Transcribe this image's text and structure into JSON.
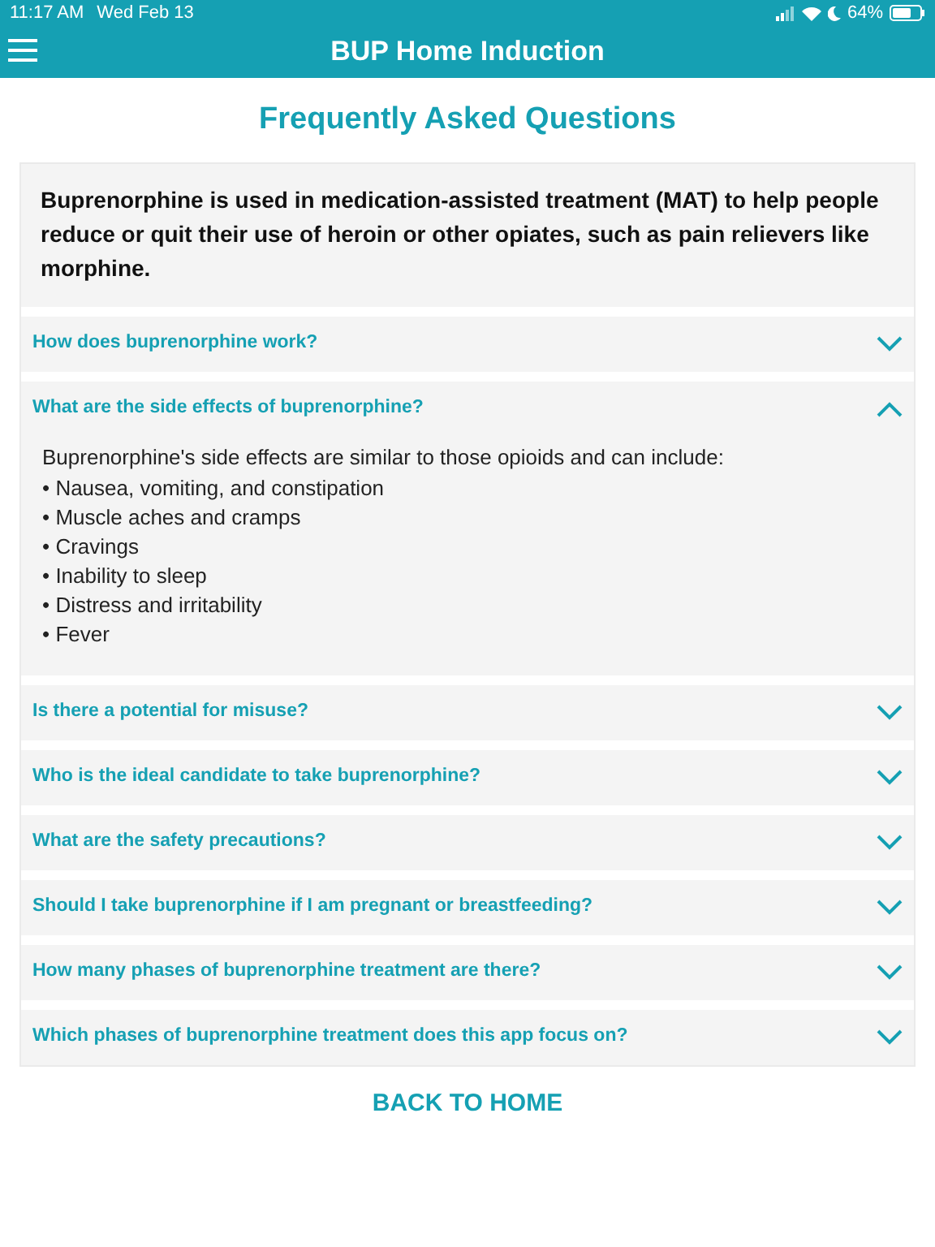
{
  "status_bar": {
    "time": "11:17 AM",
    "date": "Wed Feb 13",
    "battery": "64%"
  },
  "header": {
    "title": "BUP Home Induction"
  },
  "page_title": "Frequently Asked Questions",
  "intro": "Buprenorphine is used in medication-assisted treatment (MAT) to help people reduce or quit their use of heroin or other opiates, such as pain relievers like morphine.",
  "faq": [
    {
      "question": "How does buprenorphine work?",
      "expanded": false
    },
    {
      "question": "What are the side effects of buprenorphine?",
      "expanded": true,
      "answer": "Buprenorphine's side effects are similar to those opioids and can include:",
      "bullet": "•",
      "items": [
        "Nausea, vomiting, and constipation",
        "Muscle aches and cramps",
        "Cravings",
        "Inability to sleep",
        "Distress and irritability",
        "Fever"
      ]
    },
    {
      "question": "Is there a potential for misuse?",
      "expanded": false
    },
    {
      "question": "Who is the ideal candidate to take buprenorphine?",
      "expanded": false
    },
    {
      "question": "What are the safety precautions?",
      "expanded": false
    },
    {
      "question": "Should I take buprenorphine if I am pregnant or breastfeeding?",
      "expanded": false
    },
    {
      "question": "How many phases of buprenorphine treatment are there?",
      "expanded": false
    },
    {
      "question": "Which phases of buprenorphine treatment does this app focus on?",
      "expanded": false
    }
  ],
  "back_link": "BACK TO HOME"
}
